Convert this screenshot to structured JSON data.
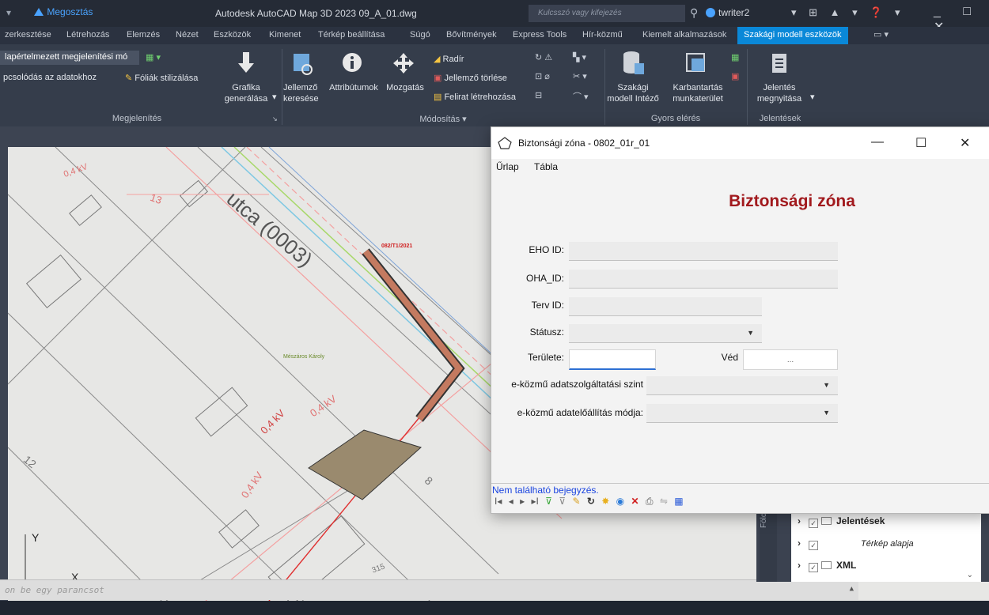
{
  "titlebar": {
    "quick_access": "▾",
    "share": "Megosztás",
    "app_title": "Autodesk AutoCAD Map 3D 2023   09_A_01.dwg",
    "search_placeholder": "Kulcsszó vagy kifejezés",
    "user": "twriter2"
  },
  "ribbon_tabs": [
    "zerkesztése",
    "Létrehozás",
    "Elemzés",
    "Nézet",
    "Eszközök",
    "Kimenet",
    "Térkép beállítása",
    "Súgó",
    "Bővítmények",
    "Express Tools",
    "Hír-közmű",
    "Kiemelt alkalmazások",
    "Szakági modell eszközök"
  ],
  "ribbon": {
    "display_combo": "lapértelmezett megjelenítési mó",
    "connect": "pcsolódás az adatokhoz",
    "style_layers": "Fóliák stilizálása",
    "graphics_gen": [
      "Grafika",
      "generálása"
    ],
    "feature_search": [
      "Jellemző",
      "keresése"
    ],
    "attributes": "Attribútumok",
    "move": "Mozgatás",
    "eraser": "Radír",
    "feature_delete": "Jellemző törlése",
    "label_create": "Felirat létrehozása",
    "model_manager": [
      "Szakági",
      "modell Intéző"
    ],
    "workspace": [
      "Karbantartás",
      "munkaterület"
    ],
    "report_open": [
      "Jelentés",
      "megnyitása"
    ],
    "groups": {
      "display": "Megjelenítés",
      "modify": "Módosítás ▾",
      "quick_access": "Gyors elérés",
      "reports": "Jelentések"
    }
  },
  "drawing": {
    "street": "utca (0003)",
    "labels": {
      "kv": "0,4 kV",
      "lot_13": "13",
      "lot_12": "12",
      "lot_8": "8",
      "lot_315": "315",
      "red_tag": "082/T1/2021",
      "owner": "Mészáros Károly",
      "axis_y": "Y",
      "axis_x": "X"
    }
  },
  "command_line": {
    "placeholder": "on be egy parancsot"
  },
  "palette": {
    "vtab": "Földm",
    "items": [
      {
        "label": "Jelentések",
        "style": "bold"
      },
      {
        "label": "Térkép alapja",
        "style": "italic"
      },
      {
        "label": "XML",
        "style": "bold"
      }
    ]
  },
  "dialog": {
    "title": "Biztonsági zóna - 0802_01r_01",
    "tabs": [
      "Űrlap",
      "Tábla"
    ],
    "heading": "Biztonsági zóna",
    "fields": {
      "eho_id": "EHO ID:",
      "oha_id": "OHA_ID:",
      "terv_id": "Terv ID:",
      "status": "Státusz:",
      "area": "Területe:",
      "ved": "Véd",
      "ved_button": "...",
      "service_level": "e-közmű adatszolgáltatási szint",
      "data_mode": "e-közmű adatelőállítás módja:"
    },
    "status_message": "Nem található bejegyzés.",
    "nav": [
      "I◂",
      "◂",
      "▸",
      "▸I"
    ]
  }
}
